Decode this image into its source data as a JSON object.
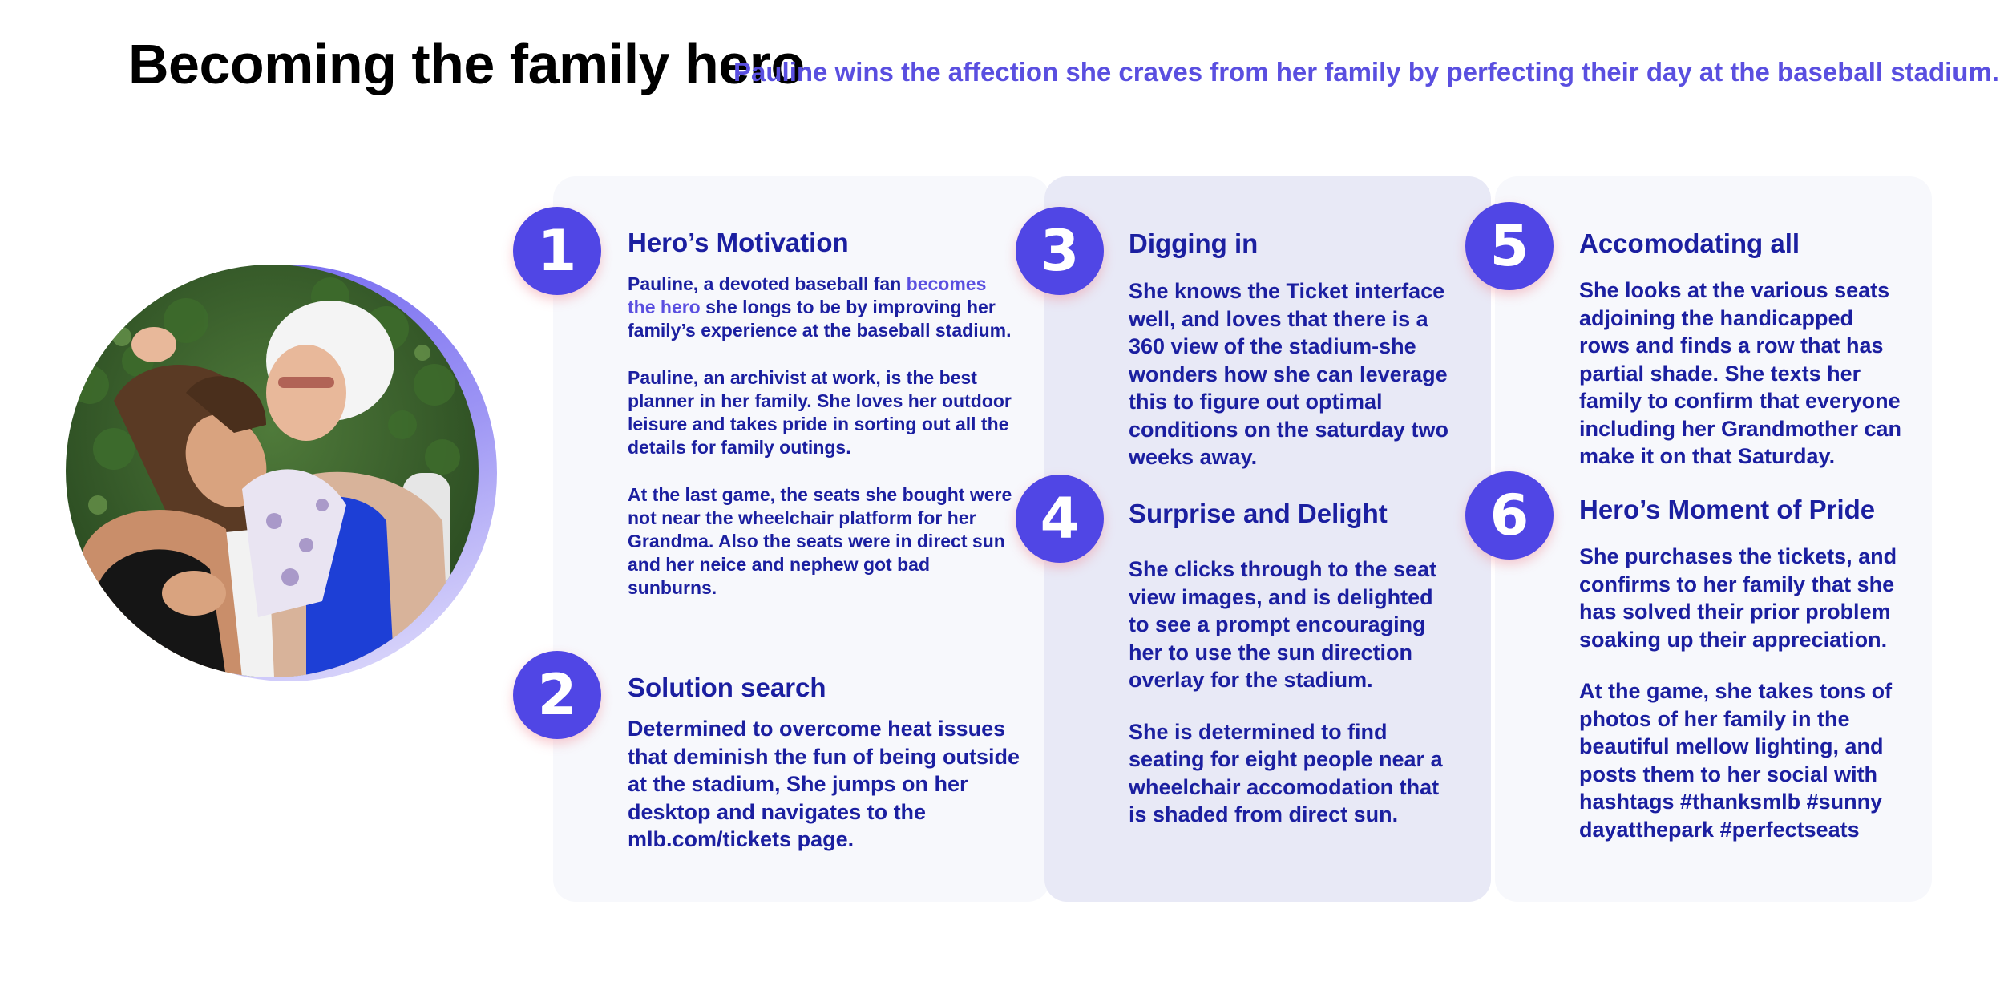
{
  "header": {
    "title": "Becoming the family hero",
    "subtitle": "Pauline wins the affection she craves from her family by perfecting their day at the baseball stadium."
  },
  "steps": [
    {
      "number": "1",
      "title": "Hero’s Motivation",
      "paragraph1": {
        "before": "Pauline, a devoted baseball fan ",
        "highlight": "becomes the hero",
        "after": " she longs to be by improving her family’s experience at the baseball stadium."
      },
      "paragraph2": "Pauline, an archivist at work, is the best planner in her family. She loves her outdoor leisure and takes pride in sorting out all the details for family outings.",
      "paragraph3": "At the last game, the seats she bought were not near the wheelchair platform for her Grandma. Also the seats were in direct sun and her neice and nephew got bad sunburns."
    },
    {
      "number": "2",
      "title": "Solution search",
      "paragraph1": "Determined to overcome heat issues that deminish the fun of being outside at the stadium, She jumps on her desktop and navigates to the mlb.com/tickets page."
    },
    {
      "number": "3",
      "title": "Digging in",
      "paragraph1": "She knows the Ticket interface well, and loves that there is a 360 view of the stadium-she wonders how she can leverage this to figure out optimal conditions on the saturday two weeks away."
    },
    {
      "number": "4",
      "title": "Surprise and Delight",
      "paragraph1": "She clicks through to the seat view images, and is delighted to see a prompt encouraging her to use the sun direction overlay for the stadium.",
      "paragraph2": "She is determined to find seating for eight people near a wheelchair accomodation that is shaded from direct sun."
    },
    {
      "number": "5",
      "title": "Accomodating all",
      "paragraph1": "She looks at the various seats adjoining the handicapped rows and finds a row that has partial shade. She texts her family to confirm that everyone including her Grandmother can make it on that Saturday."
    },
    {
      "number": "6",
      "title": "Hero’s Moment of Pride",
      "paragraph1": "She purchases the tickets, and confirms to her family that she has solved their prior problem soaking up their appreciation.",
      "paragraph2": "At the game, she takes tons of photos of her family in the beautiful mellow lighting, and posts them to her social with hashtags #thanksmlb #sunny dayatthepark #perfectseats"
    }
  ],
  "colors": {
    "accent": "#5046e5",
    "text_navy": "#1b1fa0",
    "highlight": "#5a4fe0",
    "card_light": "#f7f8fc",
    "card_mid": "#e8e9f6"
  }
}
